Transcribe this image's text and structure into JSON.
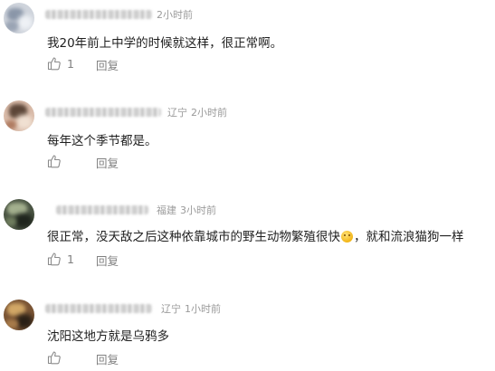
{
  "comments": [
    {
      "location": "",
      "time": "2小时前",
      "text": "我20年前上中学的时候就这样，很正常啊。",
      "likes": "1",
      "reply_label": "回复",
      "avatar_colors": [
        "#c7ccd6",
        "#7f8b9e",
        "#e9edf2"
      ]
    },
    {
      "location": "辽宁",
      "time": "2小时前",
      "text": "每年这个季节都是。",
      "likes": "",
      "reply_label": "回复",
      "avatar_colors": [
        "#c89a86",
        "#5a4a3f",
        "#e8d6c8"
      ]
    },
    {
      "location": "福建",
      "time": "3小时前",
      "text_before_emoji": "很正常，没天敌之后这种依靠城市的野生动物繁殖很快",
      "emoji_icon": "smile-emoji-icon",
      "text_after_emoji": "，就和流浪猫狗一样",
      "likes": "1",
      "reply_label": "回复",
      "avatar_colors": [
        "#3f4a3a",
        "#8f9e7a",
        "#20261f"
      ]
    },
    {
      "location": "辽宁",
      "time": "1小时前",
      "text": "沈阳这地方就是乌鸦多",
      "likes": "",
      "reply_label": "回复",
      "avatar_colors": [
        "#6b4a2e",
        "#c89a5a",
        "#2d2218"
      ]
    }
  ],
  "icons": {
    "like": "thumbs-up-icon"
  }
}
